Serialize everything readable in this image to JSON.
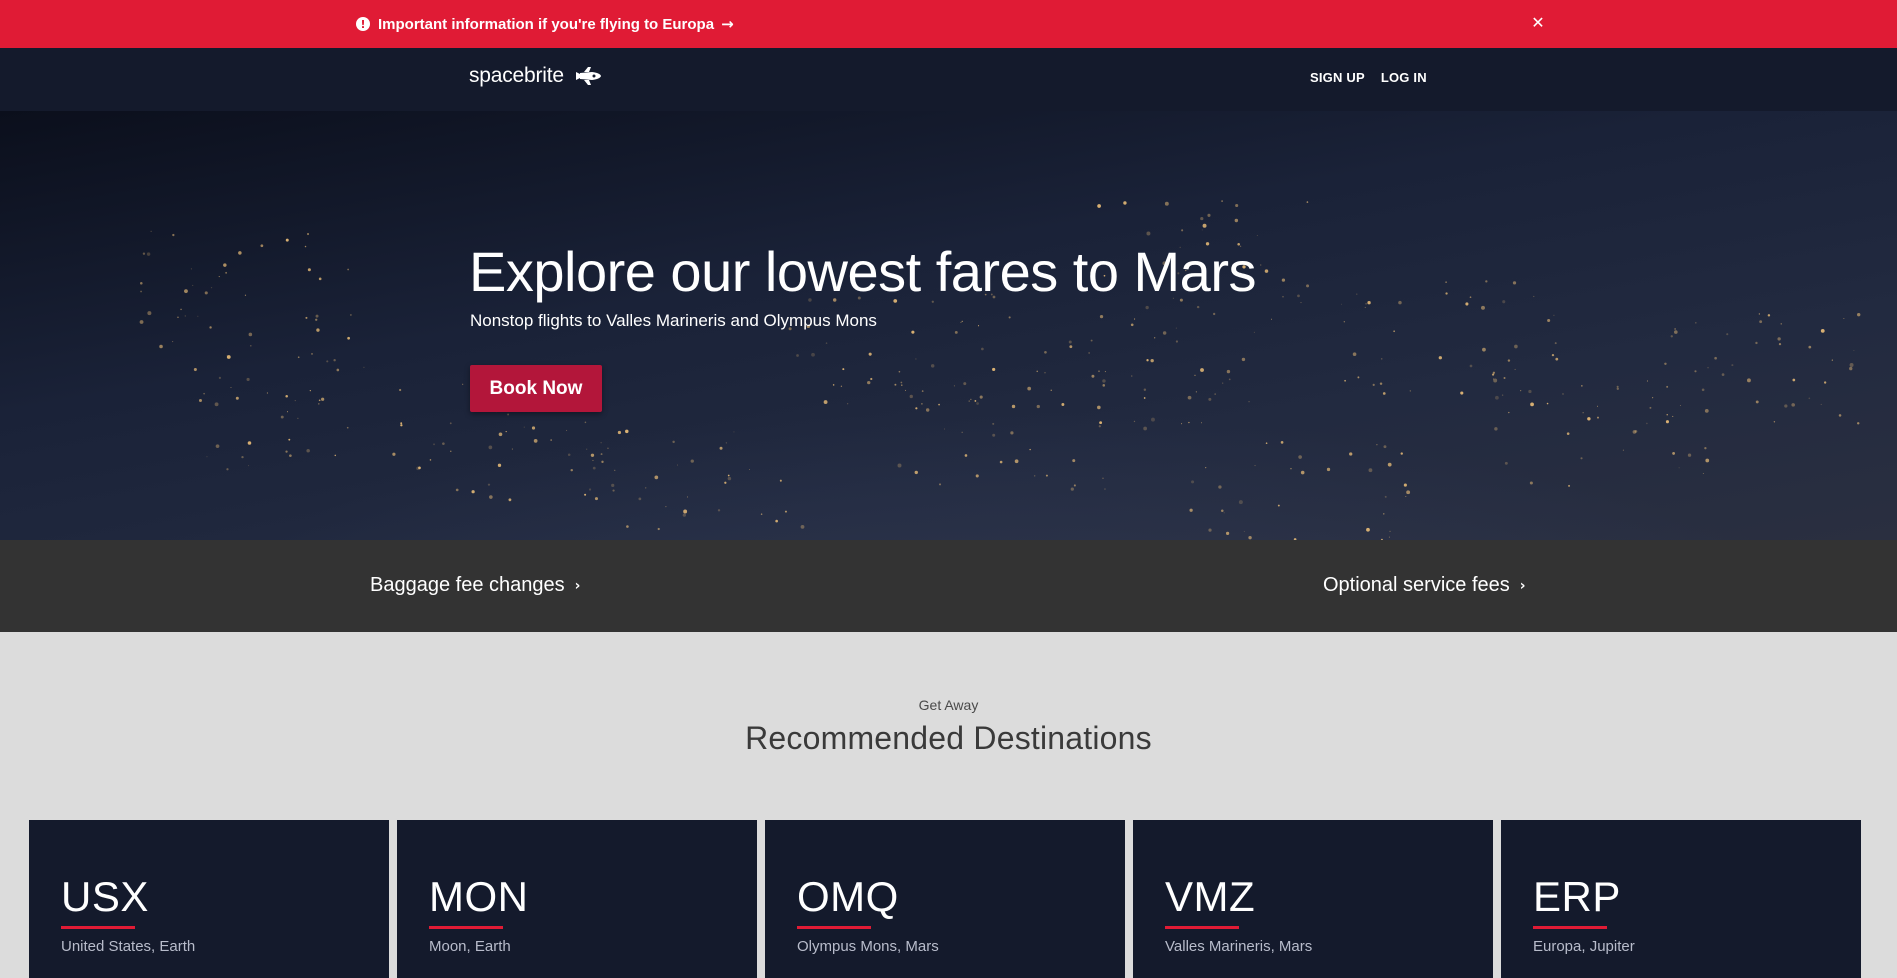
{
  "alert": {
    "message": "Important information if you're flying to Europa",
    "icon": "exclamation-circle-icon",
    "arrow_icon": "arrow-right-icon",
    "close_icon": "close-icon",
    "color": "#e01b35"
  },
  "nav": {
    "brand": "spacebrite",
    "brand_icon": "space-shuttle-icon",
    "links": [
      "SIGN UP",
      "LOG IN"
    ],
    "background": "#141a2c"
  },
  "hero": {
    "title": "Explore our lowest fares to Mars",
    "subtitle": "Nonstop flights to Valles Marineris and Olympus Mons",
    "cta": "Book Now",
    "cta_color": "#b3163a"
  },
  "strip": {
    "left_link": "Baggage fee changes",
    "right_link": "Optional service fees",
    "chevron_icon": "chevron-right-icon"
  },
  "destinations": {
    "eyebrow": "Get Away",
    "title": "Recommended Destinations",
    "cards": [
      {
        "code": "USX",
        "place": "United States, Earth"
      },
      {
        "code": "MON",
        "place": "Moon, Earth"
      },
      {
        "code": "OMQ",
        "place": "Olympus Mons, Mars"
      },
      {
        "code": "VMZ",
        "place": "Valles Marineris, Mars"
      },
      {
        "code": "ERP",
        "place": "Europa, Jupiter"
      }
    ]
  }
}
